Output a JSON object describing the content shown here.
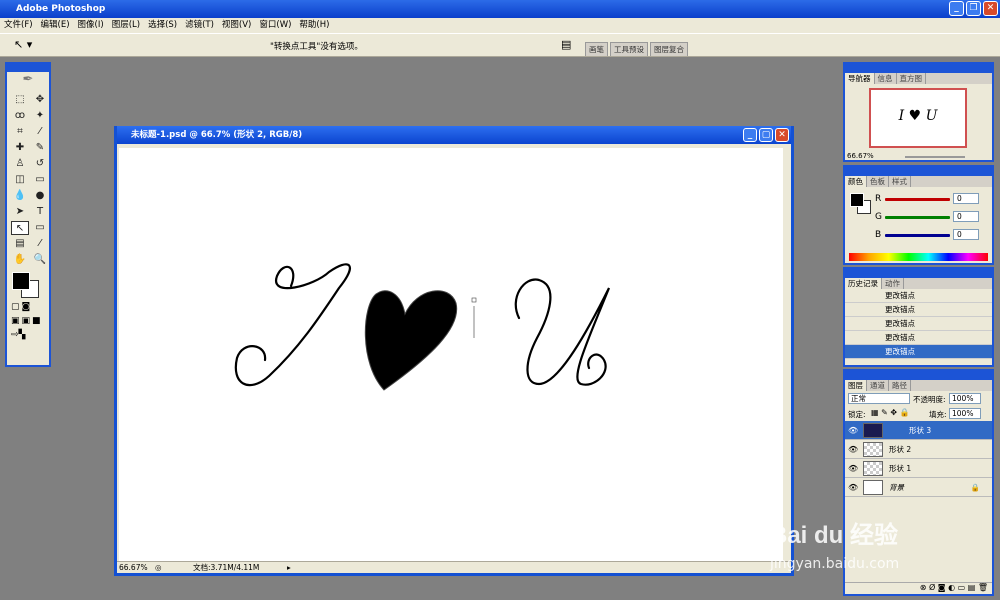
{
  "app": {
    "title": "Adobe Photoshop"
  },
  "menu": [
    "文件(F)",
    "编辑(E)",
    "图像(I)",
    "图层(L)",
    "选择(S)",
    "滤镜(T)",
    "视图(V)",
    "窗口(W)",
    "帮助(H)"
  ],
  "options": {
    "message": "\"转换点工具\"没有选项。",
    "wells": [
      "画笔",
      "工具预设",
      "图层复合"
    ]
  },
  "document": {
    "title": "未标题-1.psd @ 66.7% (形状 2, RGB/8)",
    "zoom": "66.67%",
    "docinfo": "文档:3.71M/4.11M"
  },
  "navigator": {
    "tabs": [
      "导航器",
      "信息",
      "直方图"
    ],
    "zoom": "66.67%"
  },
  "color": {
    "tabs": [
      "颜色",
      "色板",
      "样式"
    ],
    "channels": [
      {
        "label": "R",
        "value": "0"
      },
      {
        "label": "G",
        "value": "0"
      },
      {
        "label": "B",
        "value": "0"
      }
    ],
    "colors": {
      "r": "#c00000",
      "g": "#008000",
      "b": "#000090"
    }
  },
  "history": {
    "tabs": [
      "历史记录",
      "动作"
    ],
    "items": [
      "更改锚点",
      "更改锚点",
      "更改锚点",
      "更改锚点",
      "更改锚点"
    ]
  },
  "layers": {
    "tabs": [
      "图层",
      "通道",
      "路径"
    ],
    "blend": "正常",
    "opacity_label": "不透明度:",
    "opacity": "100%",
    "lock_label": "锁定:",
    "fill_label": "填充:",
    "fill": "100%",
    "items": [
      {
        "name": "形状 3",
        "selected": true
      },
      {
        "name": "形状 2",
        "selected": false
      },
      {
        "name": "形状 1",
        "selected": false
      },
      {
        "name": "背景",
        "selected": false
      }
    ]
  },
  "watermark": {
    "brand": "Bai du 经验",
    "url": "jingyan.baidu.com"
  }
}
